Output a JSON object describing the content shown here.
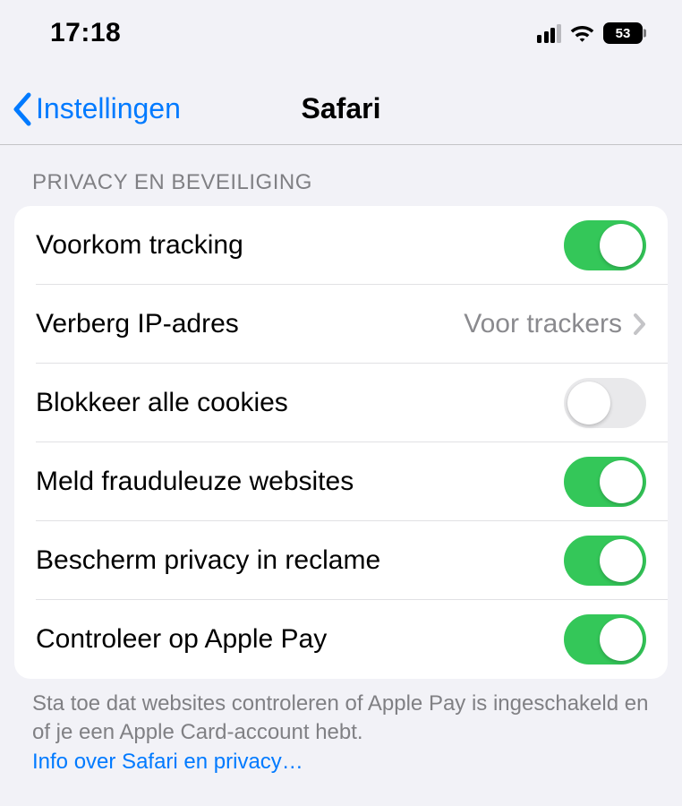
{
  "statusbar": {
    "time": "17:18",
    "battery": "53"
  },
  "nav": {
    "back_label": "Instellingen",
    "title": "Safari"
  },
  "section": {
    "header": "PRIVACY EN BEVEILIGING",
    "rows": [
      {
        "label": "Voorkom tracking",
        "toggle": true
      },
      {
        "label": "Verberg IP-adres",
        "value": "Voor trackers"
      },
      {
        "label": "Blokkeer alle cookies",
        "toggle": false
      },
      {
        "label": "Meld frauduleuze websites",
        "toggle": true
      },
      {
        "label": "Bescherm privacy in reclame",
        "toggle": true
      },
      {
        "label": "Controleer op Apple Pay",
        "toggle": true
      }
    ],
    "footer_text": "Sta toe dat websites controleren of Apple Pay is ingeschakeld en of je een Apple Card-account hebt.",
    "footer_link": "Info over Safari en privacy…"
  }
}
